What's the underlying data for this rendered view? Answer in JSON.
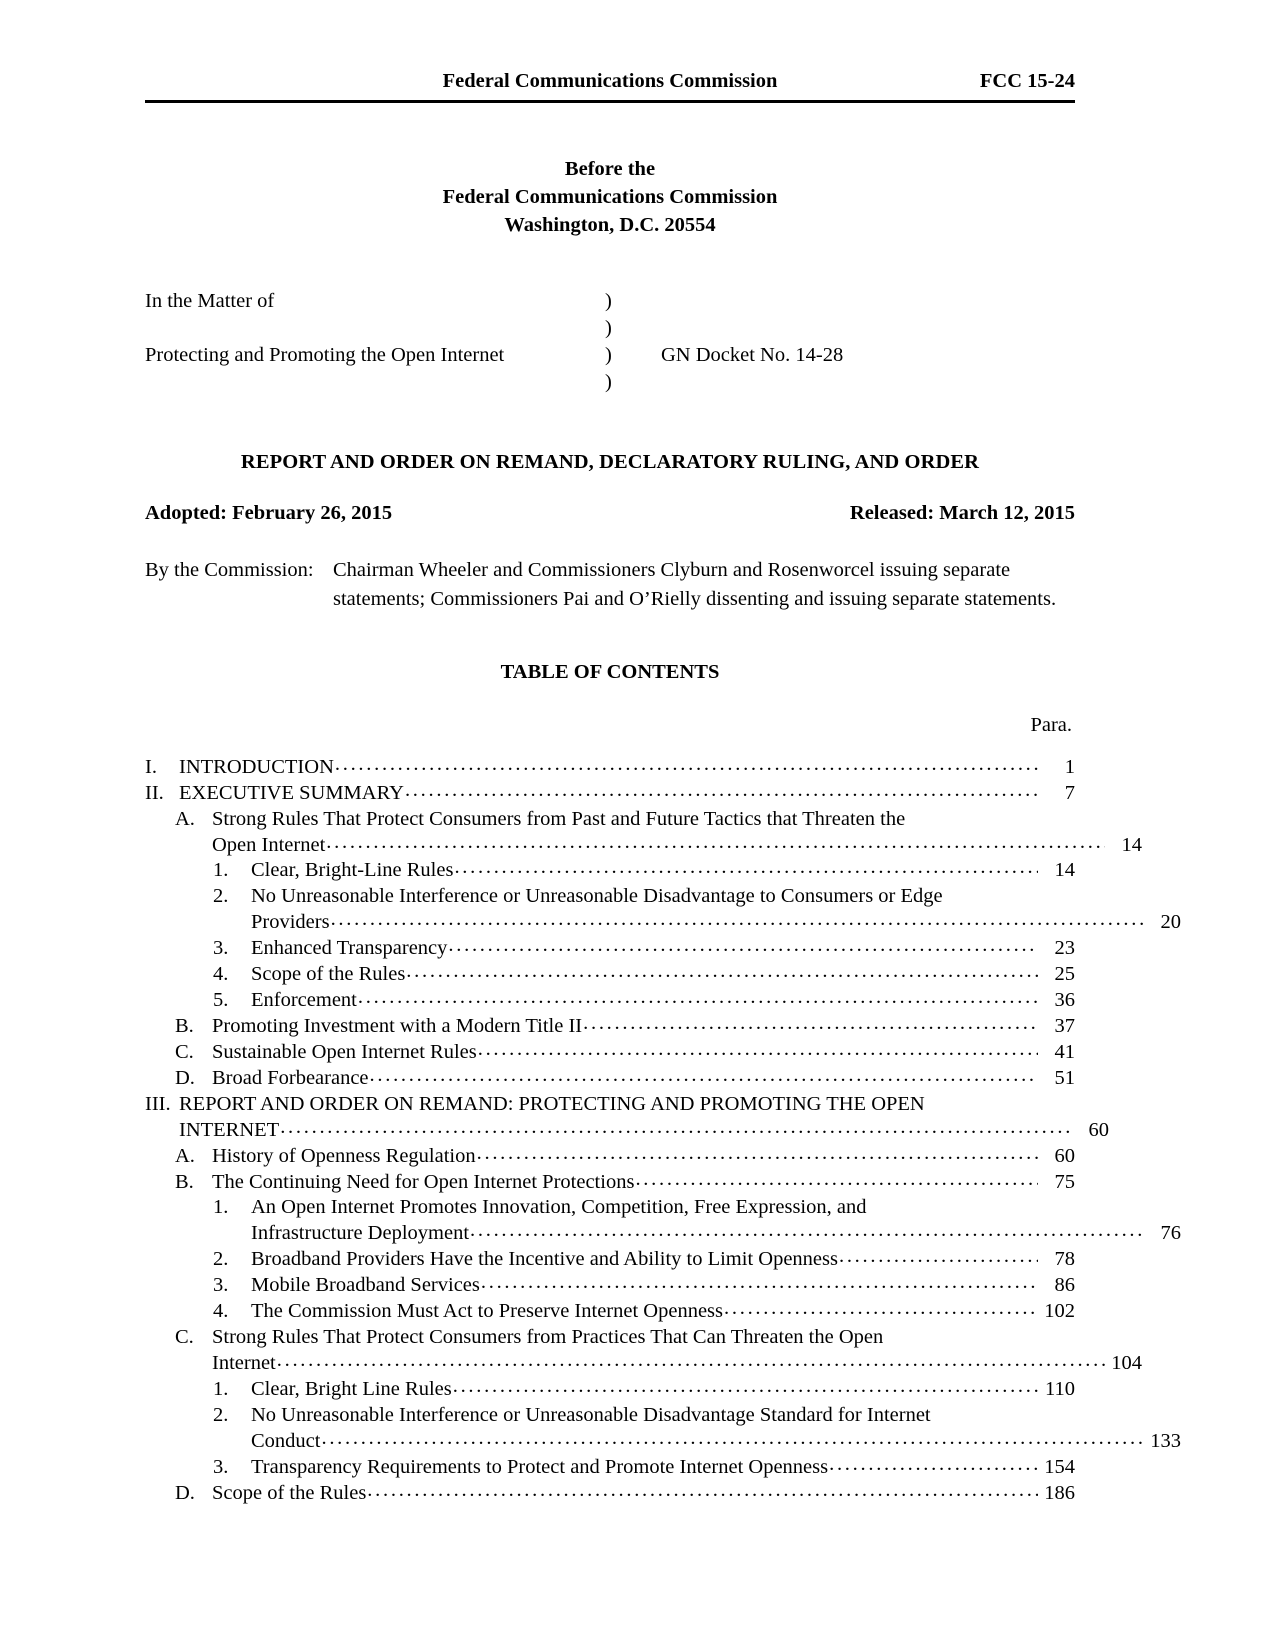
{
  "header": {
    "center": "Federal Communications Commission",
    "right": "FCC 15-24"
  },
  "caption": {
    "before_the": "Before the",
    "agency": "Federal Communications Commission",
    "location": "Washington, D.C. 20554",
    "in_the_matter_of": "In the Matter of",
    "subject": "Protecting and Promoting the Open Internet",
    "paren": ")",
    "docket": "GN Docket No. 14-28"
  },
  "order": {
    "title": "REPORT AND ORDER ON REMAND, DECLARATORY RULING, AND ORDER",
    "adopted": "Adopted:  February 26, 2015",
    "released": "Released:  March 12, 2015",
    "by_commission_label": "By the Commission:",
    "by_commission_text": "Chairman Wheeler and Commissioners Clyburn and Rosenworcel issuing separate statements; Commissioners Pai and O’Rielly dissenting and issuing separate statements."
  },
  "toc": {
    "title": "TABLE OF CONTENTS",
    "column_label": "Para.",
    "entries": [
      {
        "level": 1,
        "marker": "I.",
        "text": "INTRODUCTION",
        "page": "1"
      },
      {
        "level": 1,
        "marker": "II.",
        "text": "EXECUTIVE SUMMARY",
        "page": "7"
      },
      {
        "level": 2,
        "marker": "A.",
        "text": "Strong Rules That Protect Consumers from Past and Future Tactics that Threaten the",
        "text2": "Open Internet",
        "page": "14"
      },
      {
        "level": 3,
        "marker": "1.",
        "text": "Clear, Bright-Line Rules",
        "page": "14"
      },
      {
        "level": 3,
        "marker": "2.",
        "text": "No Unreasonable Interference or Unreasonable Disadvantage to Consumers or Edge",
        "text2": "Providers",
        "page": "20"
      },
      {
        "level": 3,
        "marker": "3.",
        "text": "Enhanced Transparency",
        "page": "23"
      },
      {
        "level": 3,
        "marker": "4.",
        "text": "Scope of the Rules",
        "page": "25"
      },
      {
        "level": 3,
        "marker": "5.",
        "text": "Enforcement",
        "page": "36"
      },
      {
        "level": 2,
        "marker": "B.",
        "text": "Promoting Investment with a Modern Title II",
        "page": "37"
      },
      {
        "level": 2,
        "marker": "C.",
        "text": "Sustainable Open Internet Rules",
        "page": "41"
      },
      {
        "level": 2,
        "marker": "D.",
        "text": "Broad Forbearance",
        "page": "51"
      },
      {
        "level": 1,
        "marker": "III.",
        "text": "REPORT AND ORDER ON REMAND: PROTECTING AND PROMOTING THE OPEN",
        "text2": "INTERNET",
        "page": "60"
      },
      {
        "level": 2,
        "marker": "A.",
        "text": "History of Openness Regulation",
        "page": "60"
      },
      {
        "level": 2,
        "marker": "B.",
        "text": "The Continuing Need for Open Internet Protections",
        "page": "75"
      },
      {
        "level": 3,
        "marker": "1.",
        "text": "An Open Internet Promotes Innovation, Competition, Free Expression, and",
        "text2": "Infrastructure Deployment",
        "page": "76"
      },
      {
        "level": 3,
        "marker": "2.",
        "text": "Broadband Providers Have the Incentive and Ability to Limit Openness",
        "page": "78"
      },
      {
        "level": 3,
        "marker": "3.",
        "text": "Mobile Broadband Services",
        "page": "86"
      },
      {
        "level": 3,
        "marker": "4.",
        "text": "The Commission Must Act to Preserve Internet Openness",
        "page": "102"
      },
      {
        "level": 2,
        "marker": "C.",
        "text": "Strong Rules That Protect Consumers from Practices That Can Threaten the Open",
        "text2": "Internet",
        "page": "104"
      },
      {
        "level": 3,
        "marker": "1.",
        "text": "Clear, Bright Line Rules",
        "page": "110"
      },
      {
        "level": 3,
        "marker": "2.",
        "text": "No Unreasonable Interference or Unreasonable Disadvantage Standard for Internet",
        "text2": "Conduct",
        "page": "133"
      },
      {
        "level": 3,
        "marker": "3.",
        "text": "Transparency Requirements to Protect and Promote Internet Openness",
        "page": "154"
      },
      {
        "level": 2,
        "marker": "D.",
        "text": "Scope of the Rules",
        "page": "186"
      }
    ]
  }
}
